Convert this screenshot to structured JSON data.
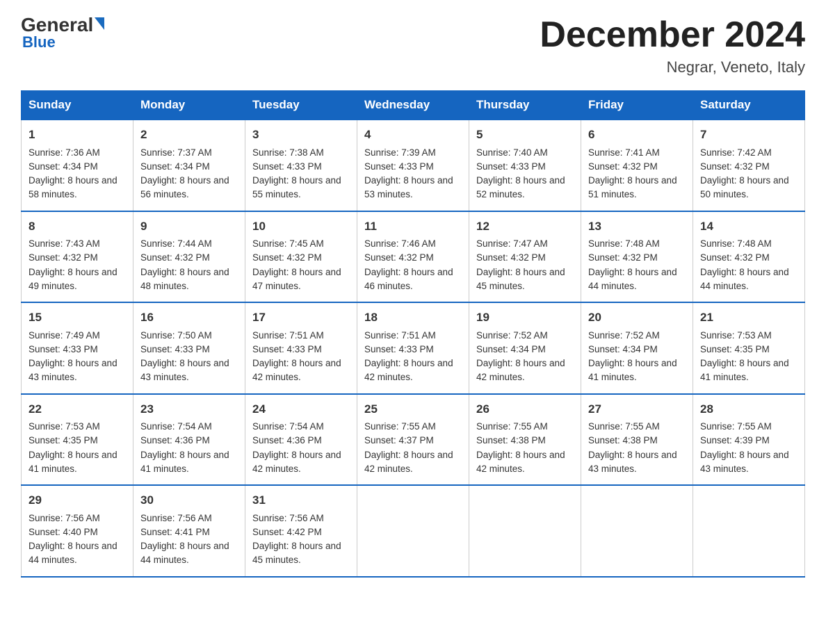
{
  "header": {
    "logo_general": "General",
    "logo_blue": "Blue",
    "month_title": "December 2024",
    "location": "Negrar, Veneto, Italy"
  },
  "days_of_week": [
    "Sunday",
    "Monday",
    "Tuesday",
    "Wednesday",
    "Thursday",
    "Friday",
    "Saturday"
  ],
  "weeks": [
    [
      {
        "day": "1",
        "sunrise": "7:36 AM",
        "sunset": "4:34 PM",
        "daylight": "8 hours and 58 minutes."
      },
      {
        "day": "2",
        "sunrise": "7:37 AM",
        "sunset": "4:34 PM",
        "daylight": "8 hours and 56 minutes."
      },
      {
        "day": "3",
        "sunrise": "7:38 AM",
        "sunset": "4:33 PM",
        "daylight": "8 hours and 55 minutes."
      },
      {
        "day": "4",
        "sunrise": "7:39 AM",
        "sunset": "4:33 PM",
        "daylight": "8 hours and 53 minutes."
      },
      {
        "day": "5",
        "sunrise": "7:40 AM",
        "sunset": "4:33 PM",
        "daylight": "8 hours and 52 minutes."
      },
      {
        "day": "6",
        "sunrise": "7:41 AM",
        "sunset": "4:32 PM",
        "daylight": "8 hours and 51 minutes."
      },
      {
        "day": "7",
        "sunrise": "7:42 AM",
        "sunset": "4:32 PM",
        "daylight": "8 hours and 50 minutes."
      }
    ],
    [
      {
        "day": "8",
        "sunrise": "7:43 AM",
        "sunset": "4:32 PM",
        "daylight": "8 hours and 49 minutes."
      },
      {
        "day": "9",
        "sunrise": "7:44 AM",
        "sunset": "4:32 PM",
        "daylight": "8 hours and 48 minutes."
      },
      {
        "day": "10",
        "sunrise": "7:45 AM",
        "sunset": "4:32 PM",
        "daylight": "8 hours and 47 minutes."
      },
      {
        "day": "11",
        "sunrise": "7:46 AM",
        "sunset": "4:32 PM",
        "daylight": "8 hours and 46 minutes."
      },
      {
        "day": "12",
        "sunrise": "7:47 AM",
        "sunset": "4:32 PM",
        "daylight": "8 hours and 45 minutes."
      },
      {
        "day": "13",
        "sunrise": "7:48 AM",
        "sunset": "4:32 PM",
        "daylight": "8 hours and 44 minutes."
      },
      {
        "day": "14",
        "sunrise": "7:48 AM",
        "sunset": "4:32 PM",
        "daylight": "8 hours and 44 minutes."
      }
    ],
    [
      {
        "day": "15",
        "sunrise": "7:49 AM",
        "sunset": "4:33 PM",
        "daylight": "8 hours and 43 minutes."
      },
      {
        "day": "16",
        "sunrise": "7:50 AM",
        "sunset": "4:33 PM",
        "daylight": "8 hours and 43 minutes."
      },
      {
        "day": "17",
        "sunrise": "7:51 AM",
        "sunset": "4:33 PM",
        "daylight": "8 hours and 42 minutes."
      },
      {
        "day": "18",
        "sunrise": "7:51 AM",
        "sunset": "4:33 PM",
        "daylight": "8 hours and 42 minutes."
      },
      {
        "day": "19",
        "sunrise": "7:52 AM",
        "sunset": "4:34 PM",
        "daylight": "8 hours and 42 minutes."
      },
      {
        "day": "20",
        "sunrise": "7:52 AM",
        "sunset": "4:34 PM",
        "daylight": "8 hours and 41 minutes."
      },
      {
        "day": "21",
        "sunrise": "7:53 AM",
        "sunset": "4:35 PM",
        "daylight": "8 hours and 41 minutes."
      }
    ],
    [
      {
        "day": "22",
        "sunrise": "7:53 AM",
        "sunset": "4:35 PM",
        "daylight": "8 hours and 41 minutes."
      },
      {
        "day": "23",
        "sunrise": "7:54 AM",
        "sunset": "4:36 PM",
        "daylight": "8 hours and 41 minutes."
      },
      {
        "day": "24",
        "sunrise": "7:54 AM",
        "sunset": "4:36 PM",
        "daylight": "8 hours and 42 minutes."
      },
      {
        "day": "25",
        "sunrise": "7:55 AM",
        "sunset": "4:37 PM",
        "daylight": "8 hours and 42 minutes."
      },
      {
        "day": "26",
        "sunrise": "7:55 AM",
        "sunset": "4:38 PM",
        "daylight": "8 hours and 42 minutes."
      },
      {
        "day": "27",
        "sunrise": "7:55 AM",
        "sunset": "4:38 PM",
        "daylight": "8 hours and 43 minutes."
      },
      {
        "day": "28",
        "sunrise": "7:55 AM",
        "sunset": "4:39 PM",
        "daylight": "8 hours and 43 minutes."
      }
    ],
    [
      {
        "day": "29",
        "sunrise": "7:56 AM",
        "sunset": "4:40 PM",
        "daylight": "8 hours and 44 minutes."
      },
      {
        "day": "30",
        "sunrise": "7:56 AM",
        "sunset": "4:41 PM",
        "daylight": "8 hours and 44 minutes."
      },
      {
        "day": "31",
        "sunrise": "7:56 AM",
        "sunset": "4:42 PM",
        "daylight": "8 hours and 45 minutes."
      },
      null,
      null,
      null,
      null
    ]
  ]
}
